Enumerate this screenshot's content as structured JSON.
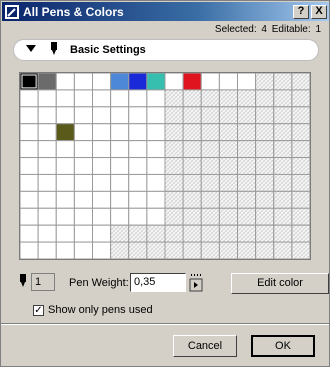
{
  "window": {
    "title": "All Pens & Colors",
    "help_btn": "?",
    "close_btn": "X"
  },
  "status": {
    "selected_label": "Selected:",
    "selected_count": "4",
    "editable_label": "Editable:",
    "editable_count": "1"
  },
  "panel": {
    "title": "Basic Settings"
  },
  "pen_grid": {
    "columns": 16,
    "rows": 11,
    "colored_cells": [
      {
        "row": 0,
        "col": 0,
        "color": "#000000",
        "selected": true
      },
      {
        "row": 0,
        "col": 1,
        "color": "#6b6b6b",
        "selected": false
      },
      {
        "row": 0,
        "col": 5,
        "color": "#4d88d8",
        "selected": false
      },
      {
        "row": 0,
        "col": 6,
        "color": "#1a2ad8",
        "selected": false
      },
      {
        "row": 0,
        "col": 7,
        "color": "#36bfae",
        "selected": false
      },
      {
        "row": 0,
        "col": 9,
        "color": "#e0141e",
        "selected": false
      },
      {
        "row": 3,
        "col": 2,
        "color": "#5a5a1a",
        "selected": false
      }
    ],
    "empty_color": "#ffffff",
    "pattern_color": "#c8c8c8"
  },
  "controls": {
    "pen_index": "1",
    "pen_weight_label": "Pen Weight:",
    "pen_weight_value": "0,35",
    "edit_color_label": "Edit color",
    "show_used_label": "Show only pens used",
    "show_used_checked": true
  },
  "buttons": {
    "cancel": "Cancel",
    "ok": "OK"
  }
}
